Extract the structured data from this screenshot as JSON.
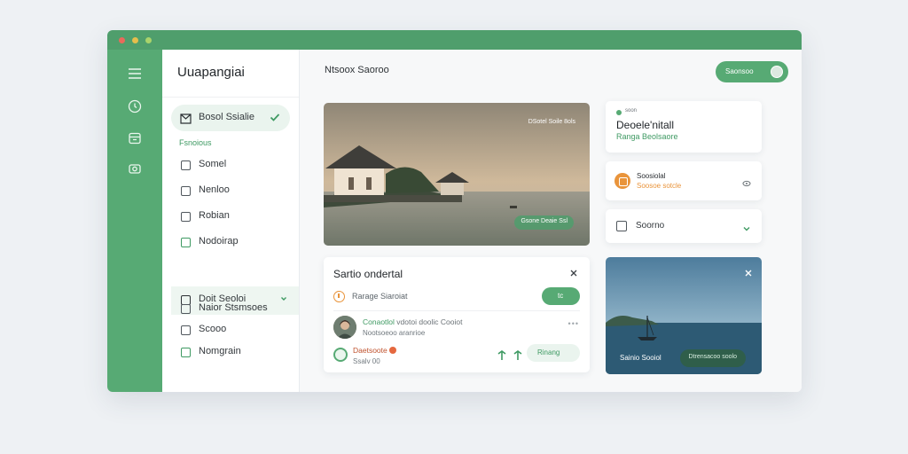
{
  "sidebar": {
    "brand": "Uuapangiai",
    "items": [
      {
        "label": "Bosol Ssialie"
      },
      {
        "label": "Somel"
      },
      {
        "label": "Nenloo"
      },
      {
        "label": "Robian"
      },
      {
        "label": "Nodoirap"
      },
      {
        "label": "Doit Seoloi"
      },
      {
        "label": "Naior Stsmsoes"
      },
      {
        "label": "Scooo"
      },
      {
        "label": "Nomgrain"
      }
    ],
    "section_label": "Fsnoious"
  },
  "header": {
    "title": "Ntsoox  Saoroo",
    "button_label": "Saonsoo"
  },
  "hero": {
    "caption": "DSotel Soile 8ols",
    "tag": "Gsone Deaie Ssl"
  },
  "dialog": {
    "title": "Sartio ondertal",
    "row1_text": "Rarage  Siaroiat",
    "toggle_label": "tc",
    "person_name": "Conaotlol",
    "person_name_rest": "vdotoi doolic Cooiot",
    "person_sub": "Nootsoeoo aranrioe",
    "row3_title": "Daetsoote",
    "row3_sub": "Ssalv 00",
    "row3_button": "Rinang"
  },
  "notification": {
    "tag": "soon",
    "title": "Deoele'nitall",
    "subtitle": "Ranga  Beolsaore"
  },
  "alert": {
    "title": "Soosiolal",
    "subtitle": "Soosoe sotcle"
  },
  "dropdown": {
    "label": "Soorno"
  },
  "photo": {
    "caption": "Sainio Sooiol",
    "button": "Dtrensacoo soolo"
  },
  "colors": {
    "accent": "#57aa74",
    "titlebar": "#4f9e6c",
    "warning": "#e9943b",
    "background": "#eef1f4"
  }
}
